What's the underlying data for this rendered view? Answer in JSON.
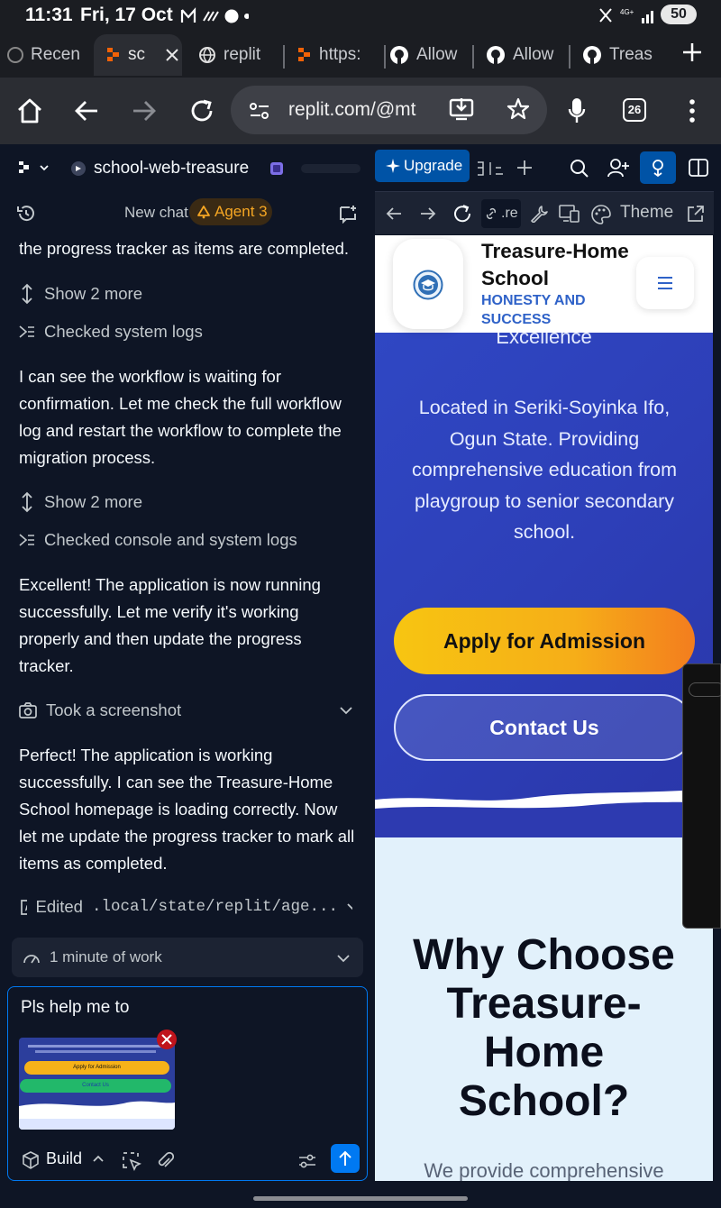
{
  "status_bar": {
    "time": "11:31",
    "date": "Fri, 17 Oct",
    "battery": "50",
    "network": "4G+"
  },
  "browser": {
    "tabs": [
      {
        "label": "Recen",
        "icon": "recent-icon",
        "active": false
      },
      {
        "label": "sc",
        "icon": "replit-icon",
        "active": true
      },
      {
        "label": "replit",
        "icon": "globe-icon",
        "active": false
      },
      {
        "label": "https:",
        "icon": "replit-icon",
        "active": false
      },
      {
        "label": "Allow",
        "icon": "github-icon",
        "active": false
      },
      {
        "label": "Allow",
        "icon": "github-icon",
        "active": false
      },
      {
        "label": "Treas",
        "icon": "github-icon",
        "active": false
      }
    ],
    "url": "replit.com/@mt",
    "tab_count": "26"
  },
  "replit": {
    "project_name": "school-web-treasure",
    "new_chat_label": "New chat",
    "agent_label": "Agent 3",
    "upgrade_label": "Upgrade",
    "chat": {
      "msg1": "the progress tracker as items are completed.",
      "show_more_1": "Show 2 more",
      "checked_system_logs": "Checked system logs",
      "msg2": "I can see the workflow is waiting for confirmation. Let me check the full workflow log and restart the workflow to complete the migration process.",
      "show_more_2": "Show 2 more",
      "checked_console_logs": "Checked console and system logs",
      "msg3": "Excellent! The application is now running successfully. Let me verify it's working properly and then update the progress tracker.",
      "took_screenshot": "Took a screenshot",
      "msg4": "Perfect! The application is working successfully. I can see the Treasure-Home School homepage is loading correctly. Now let me update the progress tracker to mark all items as completed.",
      "edited_file": ".local/state/replit/age...",
      "edited_label": "Edited",
      "work_summary": "1 minute of work"
    },
    "composer": {
      "input_text": "Pls help me to",
      "build_label": "Build",
      "thumb_button1": "Apply for Admission",
      "thumb_button2": "Contact Us"
    },
    "webview_toolbar": {
      "url_fragment": ".re",
      "theme_label": "Theme"
    }
  },
  "website": {
    "school_name": "Treasure-Home School",
    "tagline": "HONESTY AND SUCCESS",
    "hero_partial": "Excellence",
    "hero_text": "Located in Seriki-Soyinka Ifo, Ogun State. Providing comprehensive education from playgroup to senior secondary school.",
    "apply_button": "Apply for Admission",
    "contact_button": "Contact Us",
    "why_heading": "Why Choose Treasure-Home School?",
    "why_sub": "We provide comprehensive"
  },
  "colors": {
    "replit_bg": "#0e1525",
    "accent_blue": "#0079f2",
    "agent_orange": "#f5a623",
    "hero_blue": "#3049c6",
    "apply_yellow": "#f7c511",
    "apply_orange": "#f37d1e",
    "why_bg": "#e2f1fb"
  }
}
